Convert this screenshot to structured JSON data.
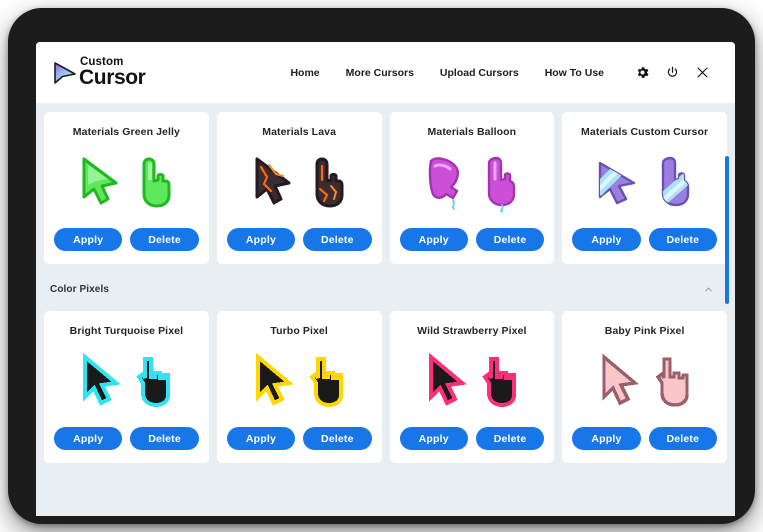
{
  "header": {
    "logo": {
      "top_word": "Custom",
      "bottom_word": "Cursor",
      "icon": "cursor-arrow-logo"
    },
    "nav_links": [
      {
        "label": "Home"
      },
      {
        "label": "More Cursors"
      },
      {
        "label": "Upload Cursors"
      },
      {
        "label": "How To Use"
      }
    ],
    "icons": [
      {
        "name": "gear-icon"
      },
      {
        "name": "power-icon"
      },
      {
        "name": "close-icon"
      }
    ]
  },
  "buttons": {
    "apply": "Apply",
    "delete": "Delete"
  },
  "sections": [
    {
      "title": null,
      "cards": [
        {
          "title": "Materials Green Jelly"
        },
        {
          "title": "Materials Lava"
        },
        {
          "title": "Materials Balloon"
        },
        {
          "title": "Materials Custom Cursor"
        }
      ]
    },
    {
      "title": "Color Pixels",
      "toggle_icon": "chevron-up-icon",
      "cards": [
        {
          "title": "Bright Turquoise Pixel"
        },
        {
          "title": "Turbo Pixel"
        },
        {
          "title": "Wild Strawberry Pixel"
        },
        {
          "title": "Baby Pink Pixel"
        }
      ]
    }
  ],
  "colors": {
    "accent_blue": "#1877e8",
    "page_background": "#e8eef2",
    "card_background": "#ffffff",
    "frame": "#1c1c1c",
    "green_jelly": "#3fd43f",
    "lava": "#ff6a00",
    "balloon": "#cc4fd8",
    "custom_cursor_purple": "#9b7fe0",
    "turquoise": "#2fe3f0",
    "turbo": "#ffd600",
    "wild_strawberry": "#ff2e79",
    "baby_pink": "#f6b9bd"
  }
}
